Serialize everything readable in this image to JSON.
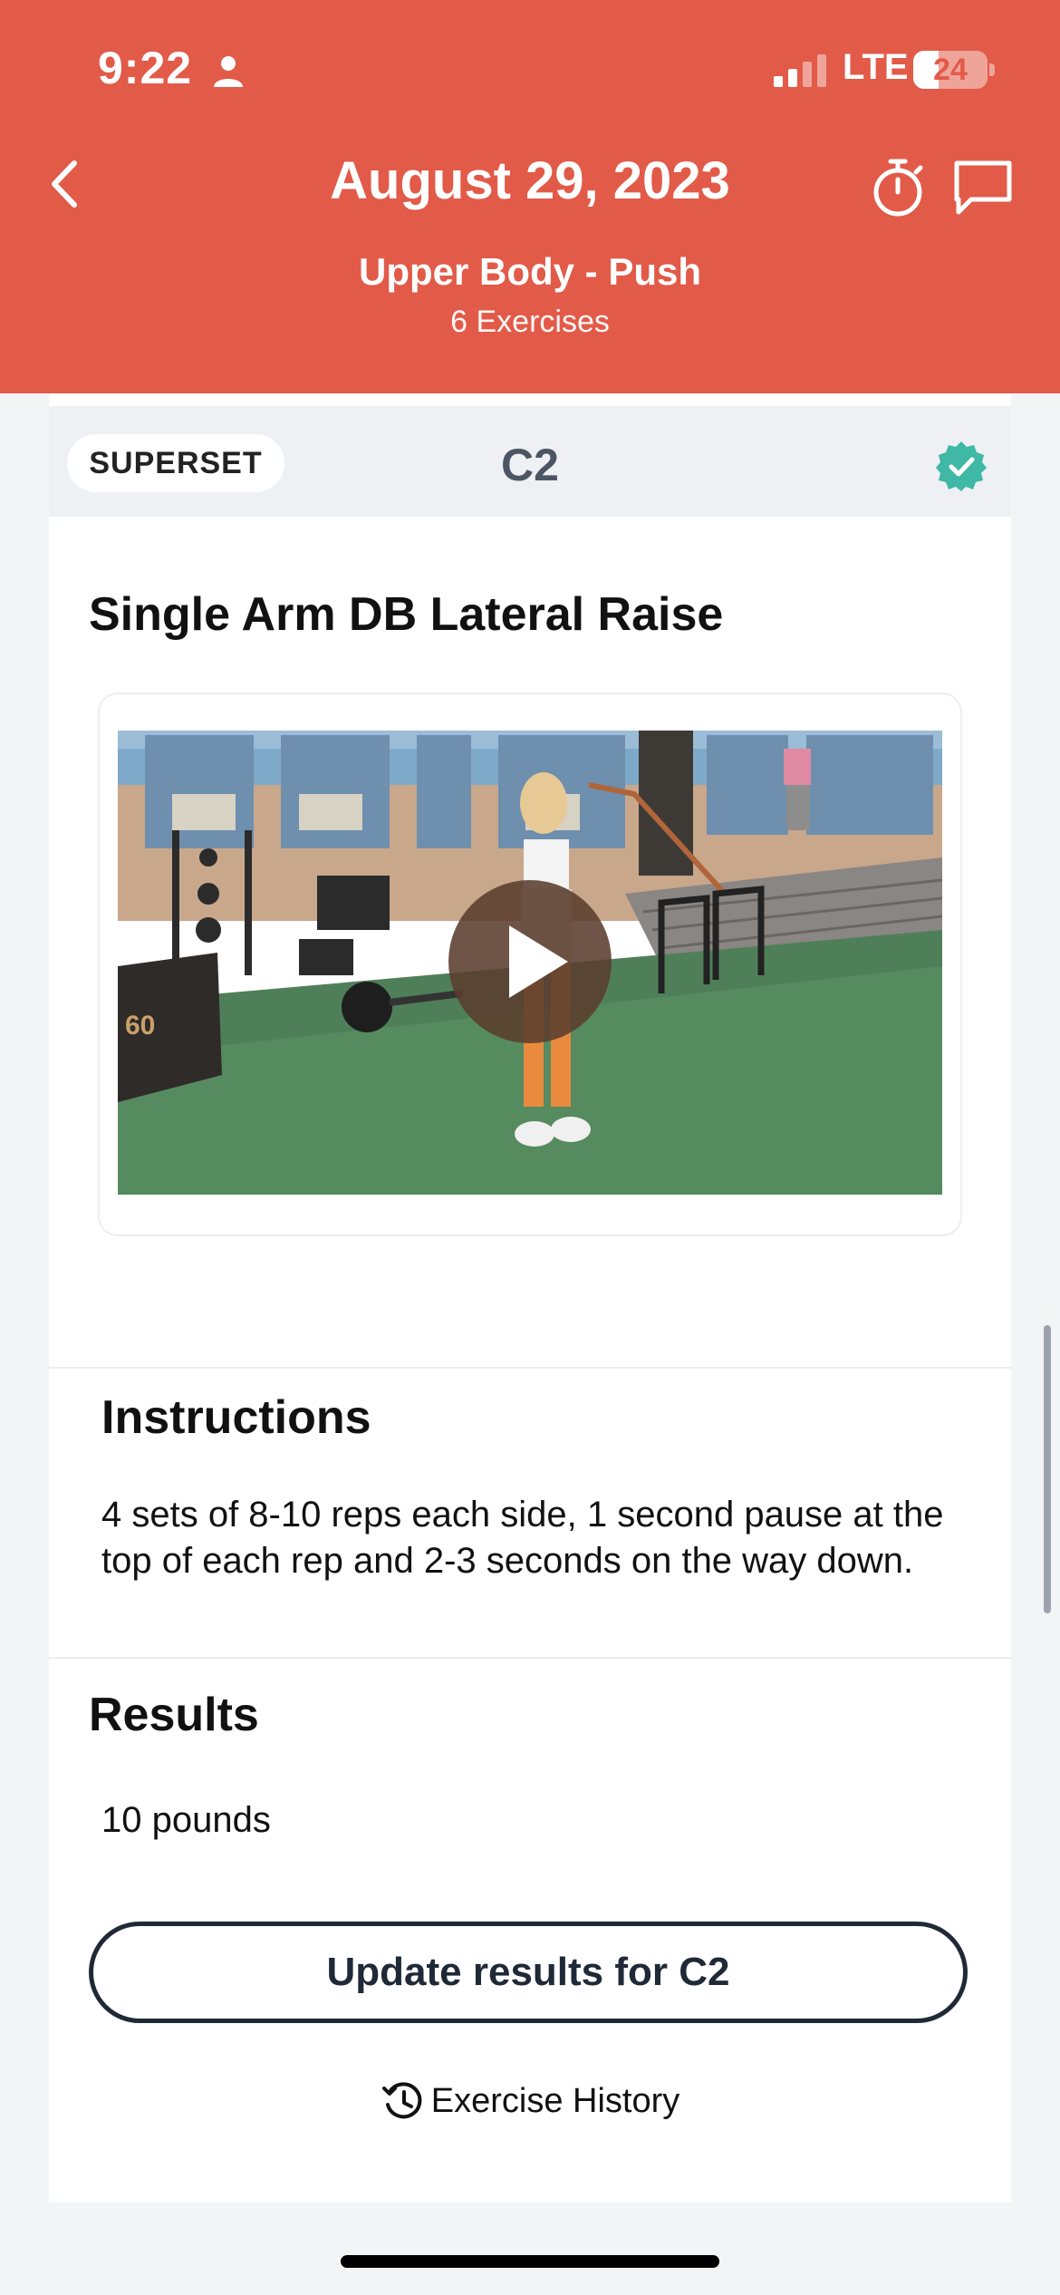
{
  "status_bar": {
    "time": "9:22",
    "network": "LTE",
    "battery": "24"
  },
  "header": {
    "date": "August 29, 2023",
    "workout_name": "Upper Body - Push",
    "exercise_count": "6 Exercises"
  },
  "superset": {
    "pill_label": "SUPERSET",
    "label": "C2",
    "completed": true
  },
  "exercise": {
    "title": "Single Arm DB Lateral Raise"
  },
  "instructions": {
    "heading": "Instructions",
    "text": "4 sets of 8-10 reps each side, 1 second pause at the top of each rep and 2-3 seconds on the way down."
  },
  "results": {
    "heading": "Results",
    "value": "10 pounds",
    "update_label": "Update results for C2"
  },
  "history": {
    "label": "Exercise History"
  },
  "colors": {
    "header": "#e25a48",
    "check": "#3fb8a5"
  }
}
